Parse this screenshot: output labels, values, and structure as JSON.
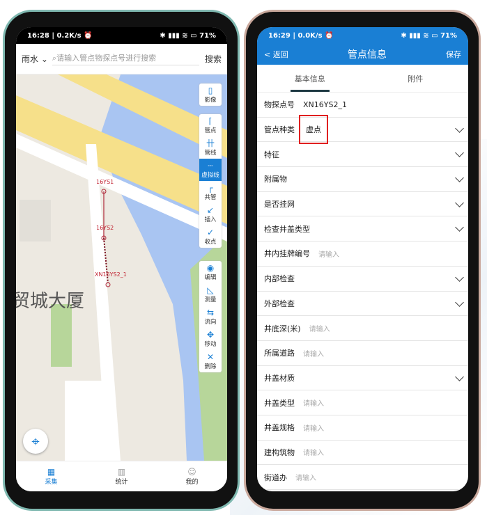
{
  "left": {
    "status": {
      "time": "16:28 | 0.2K/s ⏰",
      "right": "✱ ▮▮▮ ≋ ▭ 71%"
    },
    "search": {
      "category": "雨水",
      "placeholder": "请输入管点物探点号进行搜索",
      "button": "搜索"
    },
    "map": {
      "labels": [
        "16YS1",
        "16YS2",
        "XN16YS2_1"
      ],
      "building": "贸城大厦"
    },
    "tools_top": [
      {
        "icon": "map-icon",
        "glyph": "▯",
        "label": "影像"
      }
    ],
    "tools_mid": [
      {
        "icon": "pipe-point-icon",
        "glyph": "⌈",
        "label": "管点"
      },
      {
        "icon": "pipe-line-icon",
        "glyph": "卄",
        "label": "管线"
      },
      {
        "icon": "virtual-line-icon",
        "glyph": "┄",
        "label": "虚拟线",
        "active": true
      },
      {
        "icon": "shared-pipe-icon",
        "glyph": "┌",
        "label": "共管"
      },
      {
        "icon": "insert-icon",
        "glyph": "↙",
        "label": "插入"
      },
      {
        "icon": "close-point-icon",
        "glyph": "✓",
        "label": "收点"
      }
    ],
    "tools_bot": [
      {
        "icon": "edit-eye-icon",
        "glyph": "◉",
        "label": "编辑"
      },
      {
        "icon": "measure-icon",
        "glyph": "◺",
        "label": "测量"
      },
      {
        "icon": "flow-icon",
        "glyph": "⇆",
        "label": "流向"
      },
      {
        "icon": "move-icon",
        "glyph": "✥",
        "label": "移动"
      },
      {
        "icon": "delete-icon",
        "glyph": "✕",
        "label": "删除"
      }
    ],
    "nav": [
      {
        "label": "采集",
        "glyph": "▦",
        "active": true
      },
      {
        "label": "统计",
        "glyph": "▥"
      },
      {
        "label": "我的",
        "glyph": "☺"
      }
    ]
  },
  "right": {
    "status": {
      "time": "16:29 | 0.0K/s ⏰",
      "right": "✱ ▮▮▮ ≋ ▭ 71%"
    },
    "header": {
      "back": "< 返回",
      "title": "管点信息",
      "save": "保存"
    },
    "tabs": [
      "基本信息",
      "附件"
    ],
    "fields": [
      {
        "label": "物探点号",
        "value": "XN16YS2_1"
      },
      {
        "label": "管点种类",
        "value": "虚点",
        "dropdown": true,
        "highlight": true
      },
      {
        "label": "特征",
        "dropdown": true
      },
      {
        "label": "附属物",
        "dropdown": true
      },
      {
        "label": "是否挂网",
        "dropdown": true
      },
      {
        "label": "检查井盖类型",
        "dropdown": true
      },
      {
        "label": "井内挂牌编号",
        "placeholder": "请输入"
      },
      {
        "label": "内部检查",
        "dropdown": true
      },
      {
        "label": "外部检查",
        "dropdown": true
      },
      {
        "label": "井底深(米)",
        "placeholder": "请输入"
      },
      {
        "label": "所属道路",
        "placeholder": "请输入"
      },
      {
        "label": "井盖材质",
        "dropdown": true
      },
      {
        "label": "井盖类型",
        "placeholder": "请输入"
      },
      {
        "label": "井盖规格",
        "placeholder": "请输入"
      },
      {
        "label": "建构筑物",
        "placeholder": "请输入"
      },
      {
        "label": "街道办",
        "placeholder": "请输入"
      }
    ]
  }
}
